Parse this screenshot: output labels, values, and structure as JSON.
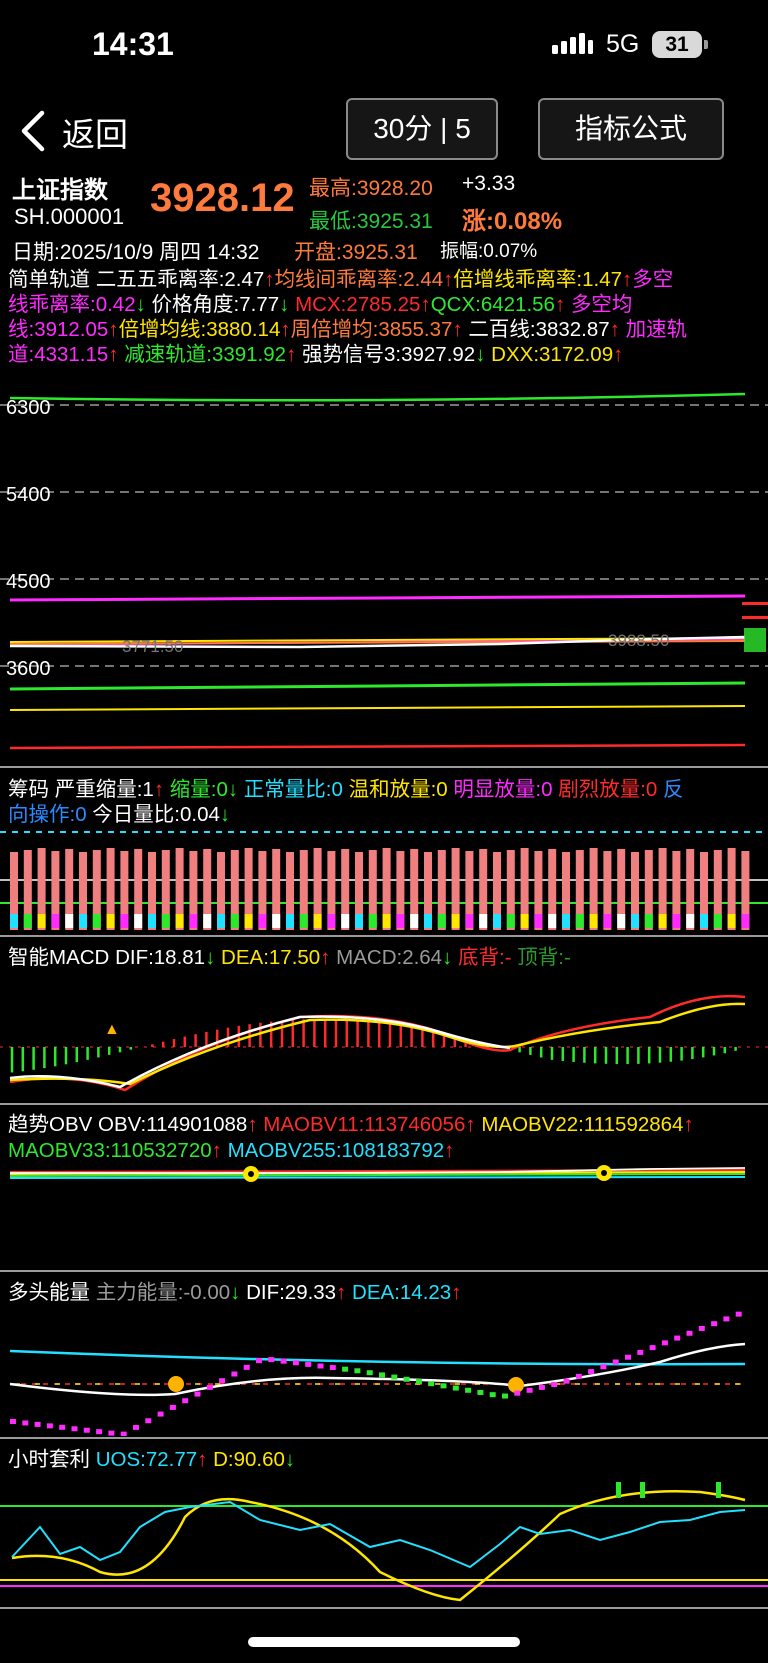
{
  "status_bar": {
    "time": "14:31",
    "network": "5G",
    "battery": "31"
  },
  "nav": {
    "back_label": "返回",
    "period_button": "30分 | 5",
    "formula_button": "指标公式"
  },
  "quote": {
    "name": "上证指数",
    "code": "SH.000001",
    "price": "3928.12",
    "high": "最高:3928.20",
    "change": "+3.33",
    "low": "最低:3925.31",
    "change_pct": "涨:0.08%",
    "date": "日期:2025/10/9 周四 14:32",
    "open": "开盘:3925.31",
    "amplitude": "振幅:0.07%"
  },
  "main_indicator": {
    "line1": [
      {
        "t": "简单轨道 ",
        "c": "w"
      },
      {
        "t": "二五五乖离率:2.47",
        "c": "w"
      },
      {
        "t": "↑",
        "c": "r"
      },
      {
        "t": "均线间乖离率:2.44",
        "c": "sal"
      },
      {
        "t": "↑",
        "c": "r"
      },
      {
        "t": "倍增线乖离率:1.47",
        "c": "y"
      },
      {
        "t": "↑",
        "c": "r"
      },
      {
        "t": "多空",
        "c": "m"
      }
    ],
    "line2": [
      {
        "t": "线乖离率:0.42",
        "c": "m"
      },
      {
        "t": "↓",
        "c": "g"
      },
      {
        "t": " 价格角度:7.77",
        "c": "w"
      },
      {
        "t": "↓",
        "c": "g"
      },
      {
        "t": " MCX:2785.25",
        "c": "r"
      },
      {
        "t": "↑",
        "c": "r"
      },
      {
        "t": "QCX:6421.56",
        "c": "g"
      },
      {
        "t": "↑",
        "c": "r"
      },
      {
        "t": " 多空均",
        "c": "m"
      }
    ],
    "line3": [
      {
        "t": "线:3912.05",
        "c": "m"
      },
      {
        "t": "↑",
        "c": "r"
      },
      {
        "t": "倍增均线:3880.14",
        "c": "y"
      },
      {
        "t": "↑",
        "c": "r"
      },
      {
        "t": "周倍增均:3855.37",
        "c": "sal"
      },
      {
        "t": "↑",
        "c": "r"
      },
      {
        "t": " 二百线:3832.87",
        "c": "w"
      },
      {
        "t": "↑",
        "c": "r"
      },
      {
        "t": " 加速轨",
        "c": "m"
      }
    ],
    "line4": [
      {
        "t": "道:4331.15",
        "c": "m"
      },
      {
        "t": "↑",
        "c": "r"
      },
      {
        "t": " 减速轨道:3391.92",
        "c": "g"
      },
      {
        "t": "↑",
        "c": "r"
      },
      {
        "t": " 强势信号3:3927.92",
        "c": "w"
      },
      {
        "t": "↓",
        "c": "g"
      },
      {
        "t": " DXX:3172.09",
        "c": "y"
      },
      {
        "t": "↑",
        "c": "r"
      }
    ],
    "y_ticks": [
      "6300",
      "5400",
      "4500",
      "3600"
    ],
    "overlay_labels": [
      "3771.50",
      "3988.50"
    ]
  },
  "volume_panel": {
    "line1": [
      {
        "t": "筹码 ",
        "c": "w"
      },
      {
        "t": "严重缩量:1",
        "c": "w"
      },
      {
        "t": "↑",
        "c": "r"
      },
      {
        "t": " 缩量:0",
        "c": "g"
      },
      {
        "t": "↓",
        "c": "g"
      },
      {
        "t": " 正常量比:0",
        "c": "c"
      },
      {
        "t": " 温和放量:0",
        "c": "y"
      },
      {
        "t": " 明显放量:0",
        "c": "m"
      },
      {
        "t": " 剧烈放量:0",
        "c": "r"
      },
      {
        "t": " 反",
        "c": "bl"
      }
    ],
    "line2": [
      {
        "t": "向操作:0",
        "c": "bl"
      },
      {
        "t": " 今日量比:0.04",
        "c": "w"
      },
      {
        "t": "↓",
        "c": "g"
      }
    ]
  },
  "macd_panel": {
    "line1": [
      {
        "t": "智能MACD ",
        "c": "w"
      },
      {
        "t": "DIF:18.81",
        "c": "w"
      },
      {
        "t": "↓",
        "c": "g"
      },
      {
        "t": " DEA:17.50",
        "c": "y"
      },
      {
        "t": "↑",
        "c": "r"
      },
      {
        "t": " MACD:2.64",
        "c": "gr"
      },
      {
        "t": "↓",
        "c": "g"
      },
      {
        "t": " 底背:-",
        "c": "dr"
      },
      {
        "t": "  顶背:-",
        "c": "dg"
      }
    ]
  },
  "obv_panel": {
    "line1": [
      {
        "t": "趋势OBV ",
        "c": "w"
      },
      {
        "t": "OBV:114901088",
        "c": "w"
      },
      {
        "t": "↑",
        "c": "r"
      },
      {
        "t": " MAOBV11:113746056",
        "c": "r"
      },
      {
        "t": "↑",
        "c": "r"
      },
      {
        "t": " MAOBV22:111592864",
        "c": "y"
      },
      {
        "t": "↑",
        "c": "r"
      }
    ],
    "line2": [
      {
        "t": "MAOBV33:110532720",
        "c": "g"
      },
      {
        "t": "↑",
        "c": "r"
      },
      {
        "t": " MAOBV255:108183792",
        "c": "c"
      },
      {
        "t": "↑",
        "c": "r"
      }
    ]
  },
  "energy_panel": {
    "line1": [
      {
        "t": "多头能量 ",
        "c": "w"
      },
      {
        "t": "主力能量:-0.00",
        "c": "gr"
      },
      {
        "t": "↓",
        "c": "g"
      },
      {
        "t": " DIF:29.33",
        "c": "w"
      },
      {
        "t": "↑",
        "c": "r"
      },
      {
        "t": " DEA:14.23",
        "c": "c"
      },
      {
        "t": "↑",
        "c": "r"
      }
    ]
  },
  "arb_panel": {
    "line1": [
      {
        "t": "小时套利 ",
        "c": "w"
      },
      {
        "t": "UOS:72.77",
        "c": "c"
      },
      {
        "t": "↑",
        "c": "r"
      },
      {
        "t": " D:90.60",
        "c": "y"
      },
      {
        "t": "↓",
        "c": "g"
      }
    ]
  },
  "colors": {
    "up": "#ff2b2b",
    "down": "#2ee82e",
    "accent": "#ff7a3d",
    "magenta": "#ff2bff",
    "cyan": "#22e0ff",
    "yellow": "#ffe600"
  }
}
